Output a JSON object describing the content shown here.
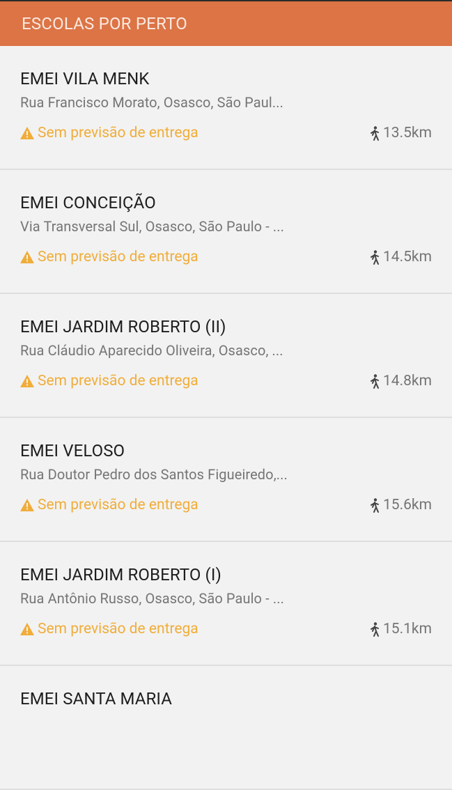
{
  "header": {
    "title": "ESCOLAS POR PERTO"
  },
  "schools": [
    {
      "name": "EMEI VILA MENK",
      "address": "Rua Francisco Morato, Osasco, São Paul...",
      "status": "Sem previsão de entrega",
      "distance": "13.5km"
    },
    {
      "name": "EMEI CONCEIÇÃO",
      "address": "Via Transversal Sul, Osasco, São Paulo - ...",
      "status": "Sem previsão de entrega",
      "distance": "14.5km"
    },
    {
      "name": "EMEI JARDIM ROBERTO (II)",
      "address": "Rua Cláudio Aparecido Oliveira, Osasco, ...",
      "status": "Sem previsão de entrega",
      "distance": "14.8km"
    },
    {
      "name": "EMEI VELOSO",
      "address": "Rua Doutor Pedro dos Santos Figueiredo,...",
      "status": "Sem previsão de entrega",
      "distance": "15.6km"
    },
    {
      "name": "EMEI JARDIM ROBERTO (I)",
      "address": "Rua Antônio Russo, Osasco, São Paulo - ...",
      "status": "Sem previsão de entrega",
      "distance": "15.1km"
    },
    {
      "name": "EMEI SANTA MARIA",
      "address": "",
      "status": "",
      "distance": ""
    }
  ],
  "icons": {
    "status": "warning-triangle",
    "distance": "walking-person"
  },
  "colors": {
    "header_bg": "#dc7446",
    "warning": "#f0ad3a",
    "background": "#f2f2f2"
  }
}
